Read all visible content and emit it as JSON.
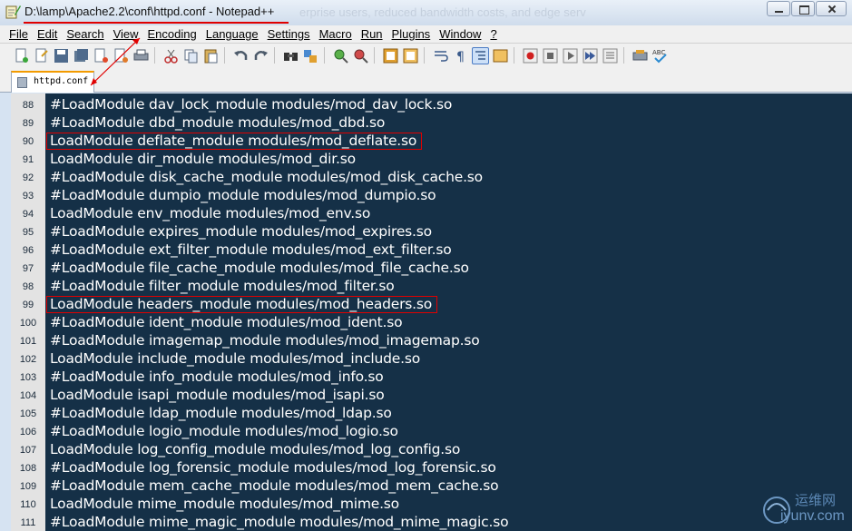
{
  "window": {
    "title": "D:\\lamp\\Apache2.2\\conf\\httpd.conf - Notepad++",
    "ghost_text": "erprise users, reduced bandwidth costs, and edge serv"
  },
  "menu": [
    "File",
    "Edit",
    "Search",
    "View",
    "Encoding",
    "Language",
    "Settings",
    "Macro",
    "Run",
    "Plugins",
    "Window",
    "?"
  ],
  "toolbar_icons": [
    "new-file-icon",
    "open-file-icon",
    "save-icon",
    "save-all-icon",
    "close-icon",
    "close-all-icon",
    "print-icon",
    "cut-icon",
    "copy-icon",
    "paste-icon",
    "undo-icon",
    "redo-icon",
    "find-icon",
    "replace-icon",
    "zoom-in-icon",
    "zoom-out-icon",
    "sync-vertical-icon",
    "sync-horizontal-icon",
    "word-wrap-icon",
    "show-all-chars-icon",
    "indent-guide-icon",
    "doc-map-icon",
    "record-macro-icon",
    "stop-macro-icon",
    "play-macro-icon",
    "run-macro-multiple-icon",
    "save-macro-icon",
    "launch-browser-icon",
    "spell-check-icon"
  ],
  "tab": {
    "label": "httpd.conf"
  },
  "lines": [
    {
      "no": "88",
      "text": "#LoadModule dav_lock_module modules/mod_dav_lock.so"
    },
    {
      "no": "89",
      "text": "#LoadModule dbd_module modules/mod_dbd.so"
    },
    {
      "no": "90",
      "text": "LoadModule deflate_module modules/mod_deflate.so",
      "highlighted": true
    },
    {
      "no": "91",
      "text": "LoadModule dir_module modules/mod_dir.so"
    },
    {
      "no": "92",
      "text": "#LoadModule disk_cache_module modules/mod_disk_cache.so"
    },
    {
      "no": "93",
      "text": "#LoadModule dumpio_module modules/mod_dumpio.so"
    },
    {
      "no": "94",
      "text": "LoadModule env_module modules/mod_env.so"
    },
    {
      "no": "95",
      "text": "#LoadModule expires_module modules/mod_expires.so"
    },
    {
      "no": "96",
      "text": "#LoadModule ext_filter_module modules/mod_ext_filter.so"
    },
    {
      "no": "97",
      "text": "#LoadModule file_cache_module modules/mod_file_cache.so"
    },
    {
      "no": "98",
      "text": "#LoadModule filter_module modules/mod_filter.so"
    },
    {
      "no": "99",
      "text": "LoadModule headers_module modules/mod_headers.so",
      "highlighted": true
    },
    {
      "no": "100",
      "text": "#LoadModule ident_module modules/mod_ident.so"
    },
    {
      "no": "101",
      "text": "#LoadModule imagemap_module modules/mod_imagemap.so"
    },
    {
      "no": "102",
      "text": "LoadModule include_module modules/mod_include.so"
    },
    {
      "no": "103",
      "text": "#LoadModule info_module modules/mod_info.so"
    },
    {
      "no": "104",
      "text": "LoadModule isapi_module modules/mod_isapi.so"
    },
    {
      "no": "105",
      "text": "#LoadModule ldap_module modules/mod_ldap.so"
    },
    {
      "no": "106",
      "text": "#LoadModule logio_module modules/mod_logio.so"
    },
    {
      "no": "107",
      "text": "LoadModule log_config_module modules/mod_log_config.so"
    },
    {
      "no": "108",
      "text": "#LoadModule log_forensic_module modules/mod_log_forensic.so"
    },
    {
      "no": "109",
      "text": "#LoadModule mem_cache_module modules/mod_mem_cache.so"
    },
    {
      "no": "110",
      "text": "LoadModule mime_module modules/mod_mime.so"
    },
    {
      "no": "111",
      "text": "#LoadModule mime_magic_module modules/mod_mime_magic.so"
    }
  ],
  "watermark": {
    "cn": "运维网",
    "en": "iyunv.com"
  },
  "colors": {
    "editor_bg": "#153047",
    "highlight": "#e00000",
    "tab_accent": "#f39b00"
  }
}
